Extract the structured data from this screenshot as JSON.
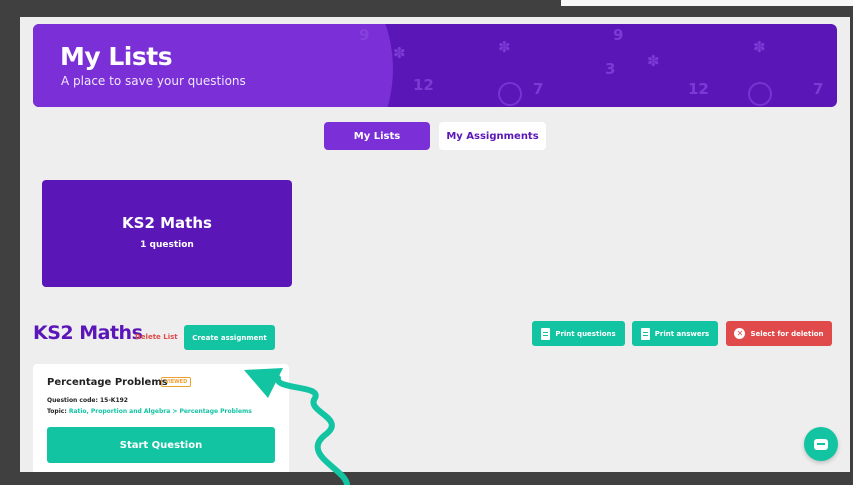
{
  "banner": {
    "title": "My Lists",
    "subtitle": "A place to save your questions",
    "decor_numbers": [
      "9",
      "12",
      "7",
      "3",
      "9",
      "12",
      "7"
    ]
  },
  "tabs": [
    {
      "label": "My Lists",
      "active": true
    },
    {
      "label": "My Assignments",
      "active": false
    }
  ],
  "list_card": {
    "title": "KS2 Maths",
    "count": "1 question"
  },
  "list_section": {
    "heading": "KS2 Maths",
    "delete_label": "Delete List",
    "create_label": "Create assignment",
    "print_questions_label": "Print questions",
    "print_answers_label": "Print answers",
    "select_delete_label": "Select for deletion"
  },
  "question": {
    "title": "Percentage Problems",
    "badge": "VIEWED",
    "code_label": "Question code:",
    "code": "15-K192",
    "topic_label": "Topic:",
    "topic": "Ratio, Proportion and Algebra > Percentage Problems",
    "start_label": "Start Question"
  },
  "colors": {
    "brand_purple": "#5b16b8",
    "accent_purple": "#7b2fd6",
    "teal": "#13c4a3",
    "danger": "#e04a4a"
  },
  "icons": {
    "print": "document-icon",
    "delete": "close-circle-icon",
    "chat": "chat-icon"
  }
}
